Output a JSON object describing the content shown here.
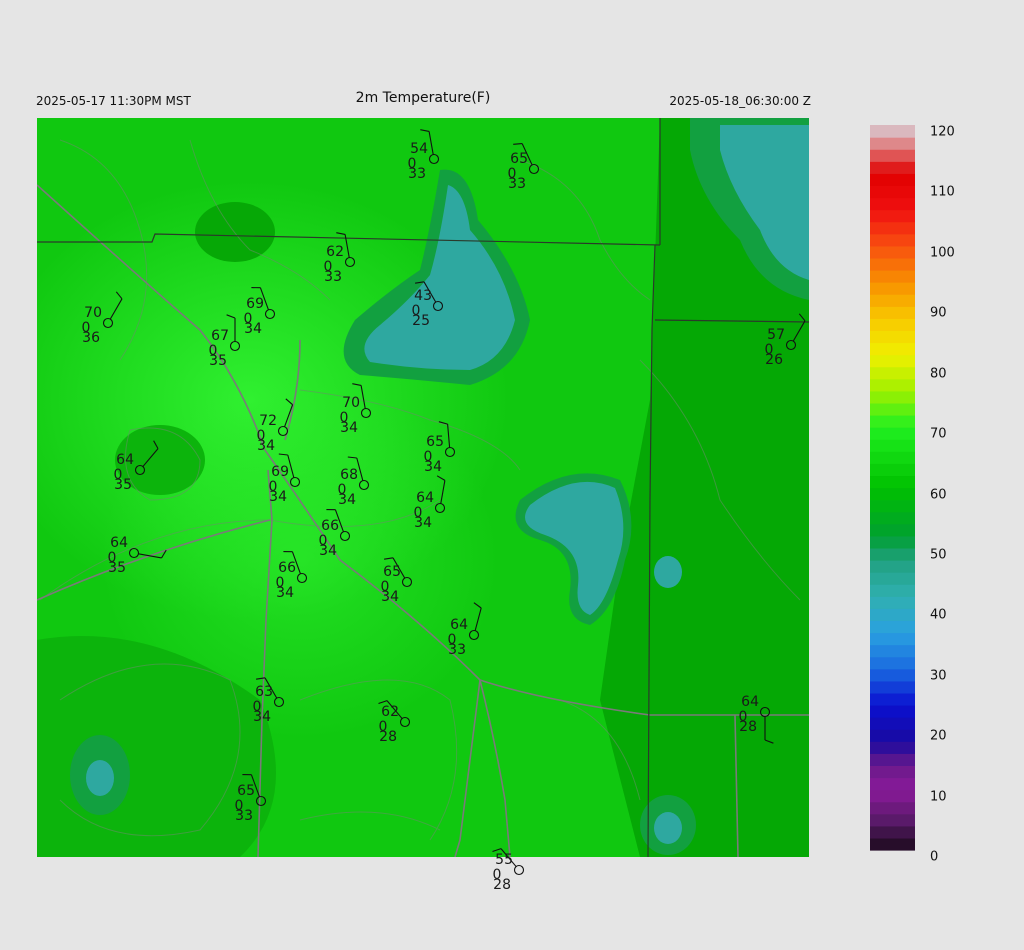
{
  "header": {
    "left": "2025-05-17 11:30PM MST",
    "title": "2m Temperature(F)",
    "right": "2025-05-18_06:30:00 Z"
  },
  "colorbar": {
    "min": 0,
    "max": 120,
    "labels": [
      "120",
      "110",
      "100",
      "90",
      "80",
      "70",
      "60",
      "50",
      "40",
      "30",
      "20",
      "10",
      "0"
    ],
    "stops": [
      {
        "value": 0,
        "color": "#1a0a1a"
      },
      {
        "value": 5,
        "color": "#5a1a6a"
      },
      {
        "value": 10,
        "color": "#8a1a9a"
      },
      {
        "value": 14,
        "color": "#6a1a8a"
      },
      {
        "value": 18,
        "color": "#1a0aa0"
      },
      {
        "value": 24,
        "color": "#0a10d0"
      },
      {
        "value": 30,
        "color": "#1a6ae0"
      },
      {
        "value": 36,
        "color": "#2aa0e0"
      },
      {
        "value": 42,
        "color": "#30b0b0"
      },
      {
        "value": 48,
        "color": "#20a080"
      },
      {
        "value": 52,
        "color": "#00a030"
      },
      {
        "value": 60,
        "color": "#00c000"
      },
      {
        "value": 70,
        "color": "#20f020"
      },
      {
        "value": 76,
        "color": "#a0f000"
      },
      {
        "value": 82,
        "color": "#f0f000"
      },
      {
        "value": 88,
        "color": "#f8c800"
      },
      {
        "value": 94,
        "color": "#f89000"
      },
      {
        "value": 100,
        "color": "#f85010"
      },
      {
        "value": 106,
        "color": "#f01010"
      },
      {
        "value": 112,
        "color": "#e00000"
      },
      {
        "value": 116,
        "color": "#e07070"
      },
      {
        "value": 120,
        "color": "#d8d0d8"
      }
    ]
  },
  "stations": [
    {
      "t": "54",
      "w": "0",
      "td": "33"
    },
    {
      "t": "65",
      "w": "0",
      "td": "33"
    },
    {
      "t": "62",
      "w": "0",
      "td": "33"
    },
    {
      "t": "43",
      "w": "0",
      "td": "25"
    },
    {
      "t": "70",
      "w": "0",
      "td": "36"
    },
    {
      "t": "69",
      "w": "0",
      "td": "34"
    },
    {
      "t": "67",
      "w": "0",
      "td": "35"
    },
    {
      "t": "57",
      "w": "0",
      "td": "26"
    },
    {
      "t": "70",
      "w": "0",
      "td": "34"
    },
    {
      "t": "72",
      "w": "0",
      "td": "34"
    },
    {
      "t": "65",
      "w": "0",
      "td": "34"
    },
    {
      "t": "64",
      "w": "0",
      "td": "35"
    },
    {
      "t": "69",
      "w": "0",
      "td": "34"
    },
    {
      "t": "68",
      "w": "0",
      "td": "34"
    },
    {
      "t": "64",
      "w": "0",
      "td": "34"
    },
    {
      "t": "64",
      "w": "0",
      "td": "35"
    },
    {
      "t": "66",
      "w": "0",
      "td": "34"
    },
    {
      "t": "66",
      "w": "0",
      "td": "34"
    },
    {
      "t": "65",
      "w": "0",
      "td": "34"
    },
    {
      "t": "64",
      "w": "0",
      "td": "33"
    },
    {
      "t": "63",
      "w": "0",
      "td": "34"
    },
    {
      "t": "62",
      "w": "0",
      "td": "28"
    },
    {
      "t": "64",
      "w": "0",
      "td": "28"
    },
    {
      "t": "65",
      "w": "0",
      "td": "33"
    },
    {
      "t": "55",
      "w": "0",
      "td": "28"
    }
  ]
}
